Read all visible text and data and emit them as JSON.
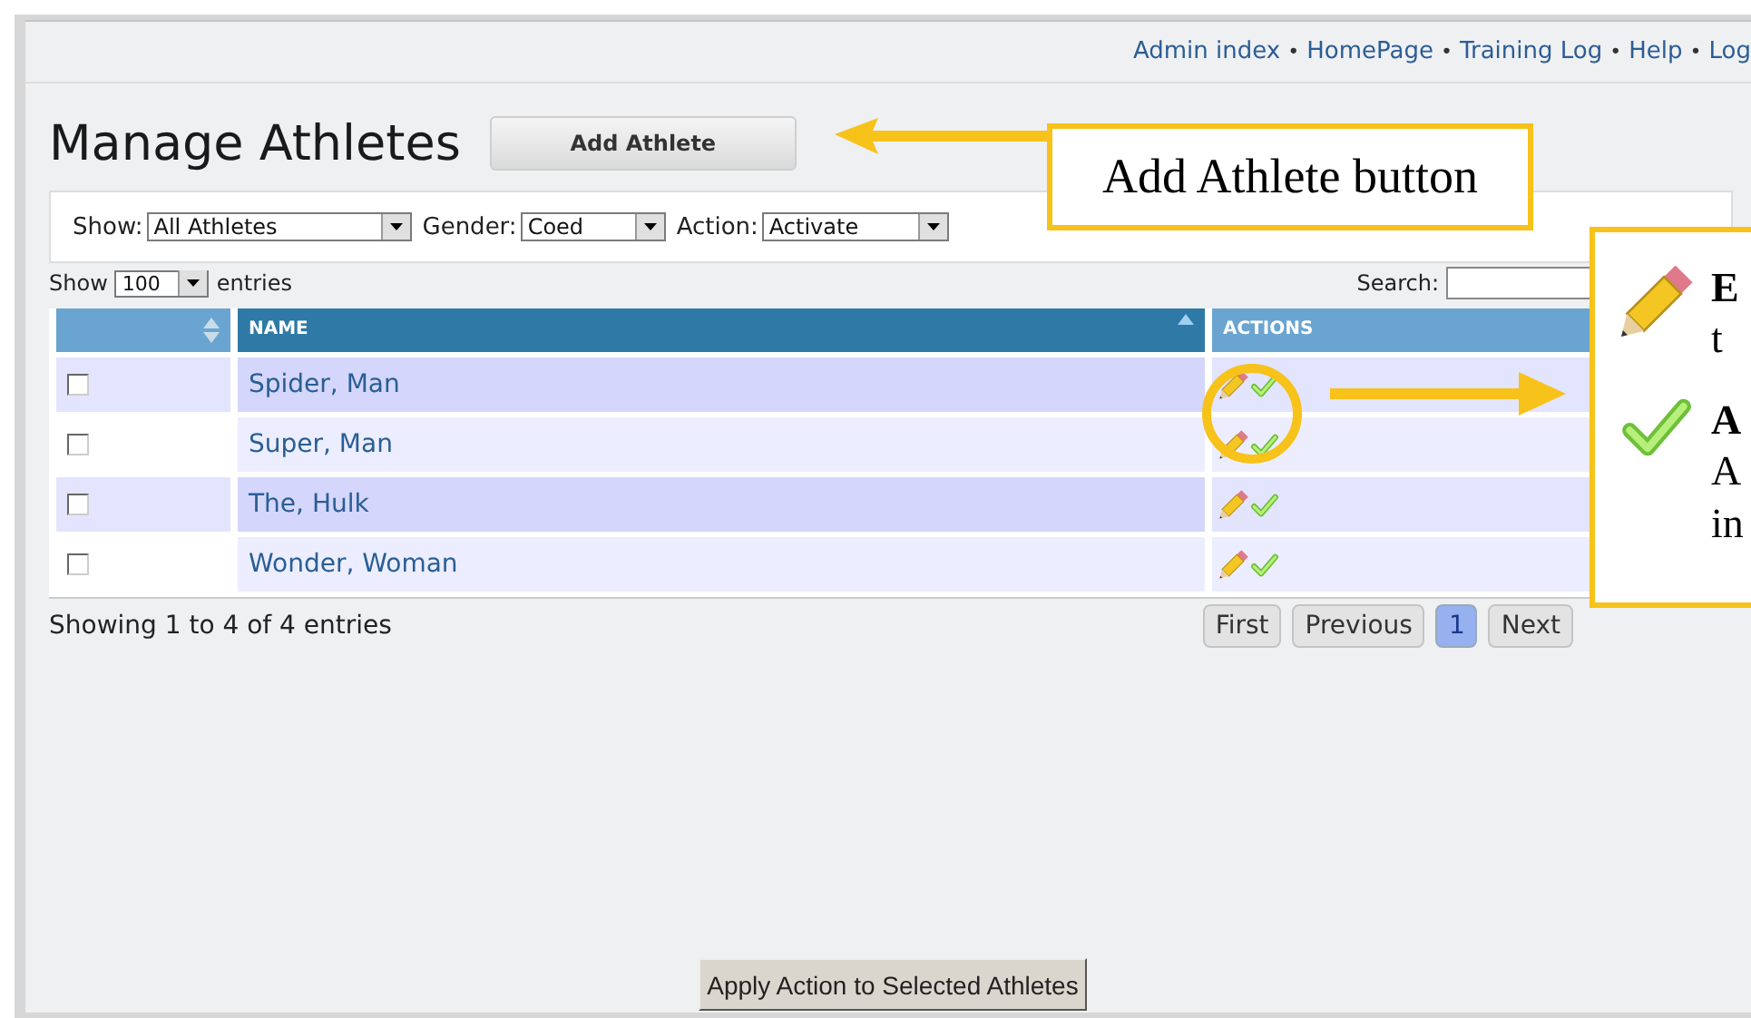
{
  "nav_links": [
    {
      "kind": "link",
      "text": "Admin index"
    },
    {
      "kind": "bullet",
      "text": "•"
    },
    {
      "kind": "link",
      "text": "HomePage"
    },
    {
      "kind": "bullet",
      "text": "•"
    },
    {
      "kind": "link",
      "text": "Training Log"
    },
    {
      "kind": "bullet",
      "text": "•"
    },
    {
      "kind": "link",
      "text": "Help"
    },
    {
      "kind": "bullet",
      "text": "•"
    },
    {
      "kind": "link",
      "text": "Log"
    }
  ],
  "title": "Manage Athletes",
  "add_button": "Add Athlete",
  "filters": [
    {
      "label": "Show:",
      "value": "All Athletes"
    },
    {
      "label": "Gender:",
      "value": "Coed"
    },
    {
      "label": "Action:",
      "value": "Activate"
    }
  ],
  "page_length": {
    "label_before": "Show",
    "value": "100",
    "label_after": "entries"
  },
  "search": {
    "label": "Search:"
  },
  "table": {
    "columns": [
      "NAME",
      "ACTIONS"
    ],
    "rows": [
      {
        "checked": false,
        "name": "Spider, Man"
      },
      {
        "checked": false,
        "name": "Super, Man"
      },
      {
        "checked": false,
        "name": "The, Hulk"
      },
      {
        "checked": false,
        "name": "Wonder, Woman"
      }
    ]
  },
  "info": "Showing 1 to 4 of 4 entries",
  "pagination": [
    {
      "label": "First",
      "selected": false
    },
    {
      "label": "Previous",
      "selected": false
    },
    {
      "label": "1",
      "selected": true
    },
    {
      "label": "Next",
      "selected": false
    }
  ],
  "apply_button": "Apply Action to Selected Athletes",
  "annotations": {
    "button_label": "Add Athlete button",
    "legend": [
      {
        "title": "E",
        "lines": [
          "t"
        ]
      },
      {
        "title": "A",
        "lines": [
          "A",
          "in"
        ]
      }
    ]
  }
}
